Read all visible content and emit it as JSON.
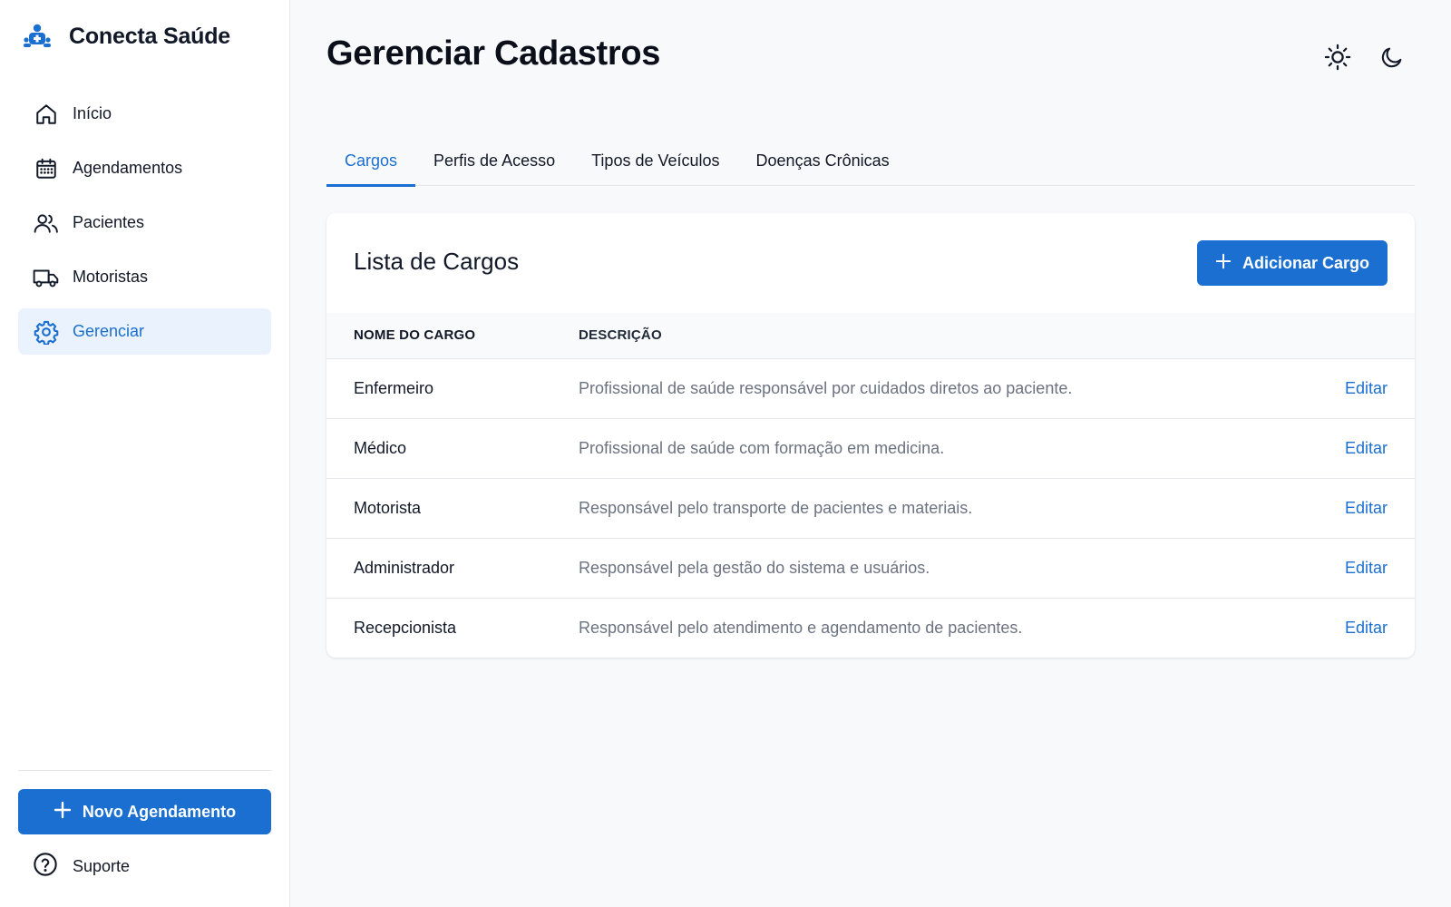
{
  "app": {
    "name": "Conecta Saúde"
  },
  "sidebar": {
    "items": [
      {
        "label": "Início",
        "icon": "home-icon"
      },
      {
        "label": "Agendamentos",
        "icon": "calendar-icon"
      },
      {
        "label": "Pacientes",
        "icon": "users-icon"
      },
      {
        "label": "Motoristas",
        "icon": "truck-icon"
      },
      {
        "label": "Gerenciar",
        "icon": "gear-icon",
        "active": true
      }
    ],
    "new_button": "Novo Agendamento",
    "support": "Suporte"
  },
  "header": {
    "title": "Gerenciar Cadastros",
    "theme_icons": [
      "sun-icon",
      "moon-icon"
    ]
  },
  "tabs": [
    {
      "label": "Cargos",
      "active": true
    },
    {
      "label": "Perfis de Acesso"
    },
    {
      "label": "Tipos de Veículos"
    },
    {
      "label": "Doenças Crônicas"
    }
  ],
  "card": {
    "title": "Lista de Cargos",
    "add_button": "Adicionar Cargo",
    "columns": [
      "NOME DO CARGO",
      "DESCRIÇÃO"
    ],
    "rows": [
      {
        "name": "Enfermeiro",
        "description": "Profissional de saúde responsável por cuidados diretos ao paciente.",
        "action": "Editar"
      },
      {
        "name": "Médico",
        "description": "Profissional de saúde com formação em medicina.",
        "action": "Editar"
      },
      {
        "name": "Motorista",
        "description": "Responsável pelo transporte de pacientes e materiais.",
        "action": "Editar"
      },
      {
        "name": "Administrador",
        "description": "Responsável pela gestão do sistema e usuários.",
        "action": "Editar"
      },
      {
        "name": "Recepcionista",
        "description": "Responsável pelo atendimento e agendamento de pacientes.",
        "action": "Editar"
      }
    ]
  },
  "colors": {
    "accent": "#1b6fd0",
    "active_bg": "#eaf2fd",
    "background": "#f8f9fb"
  }
}
